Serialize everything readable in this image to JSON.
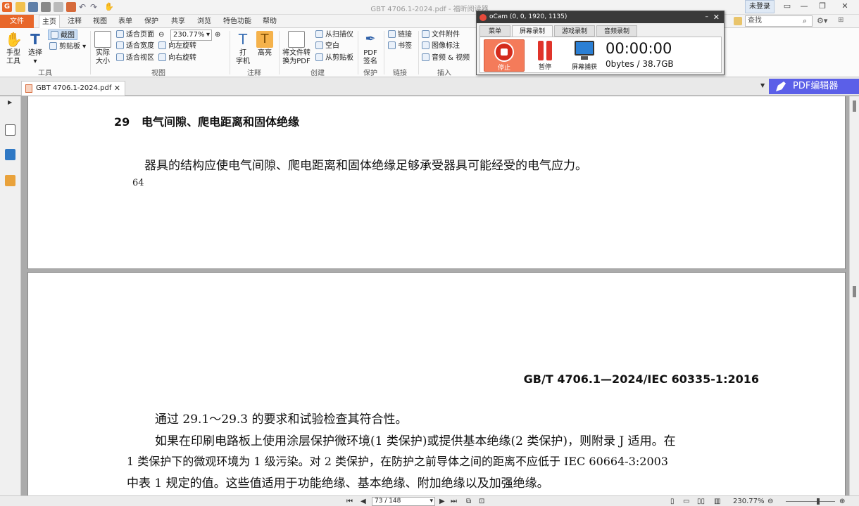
{
  "window": {
    "title": "GBT 4706.1-2024.pdf - 福昕阅读器",
    "login": "未登录",
    "app_logo_letter": "G"
  },
  "menu": {
    "file": "文件",
    "tabs": [
      "主页",
      "注释",
      "视图",
      "表单",
      "保护",
      "共享",
      "浏览",
      "特色功能",
      "帮助"
    ],
    "search_placeholder": "查找"
  },
  "ribbon": {
    "tools": {
      "hand": "手型\n工具",
      "select": "选择",
      "screenshot": "截图",
      "clipboard": "剪贴板",
      "group": "工具"
    },
    "view": {
      "actual_size": "实际\n大小",
      "fit_page": "适合页面",
      "fit_width": "适合宽度",
      "fit_view": "适合视区",
      "zoom_value": "230.77%",
      "rotate_left": "向左旋转",
      "rotate_right": "向右旋转",
      "group": "视图"
    },
    "annotate": {
      "typewriter": "打\n字机",
      "highlight": "高亮",
      "group": "注释"
    },
    "create": {
      "convert": "将文件转\n换为PDF",
      "from_scanner": "从扫描仪",
      "blank": "空白",
      "from_clipboard": "从剪贴板",
      "group": "创建"
    },
    "protect": {
      "sign": "PDF\n签名",
      "group": "保护"
    },
    "links": {
      "link": "链接",
      "bookmark": "书签",
      "group": "链接"
    },
    "insert": {
      "attachment": "文件附件",
      "image_annotation": "图像标注",
      "audio_video": "音频 & 视频",
      "group": "插入"
    }
  },
  "doc_tab": {
    "name": "GBT 4706.1-2024.pdf",
    "close": "✕"
  },
  "pdf_editor_label": "PDF编辑器",
  "page1": {
    "section_number": "29",
    "section_title": "电气间隙、爬电距离和固体绝缘",
    "paragraph": "器具的结构应使电气间隙、爬电距离和固体绝缘足够承受器具可能经受的电气应力。",
    "page_number": "64"
  },
  "page2": {
    "header": "GB/T  4706.1—2024/IEC 60335-1:2016",
    "line1": "通过 29.1～29.3 的要求和试验检查其符合性。",
    "line2": "如果在印刷电路板上使用涂层保护微环境(1 类保护)或提供基本绝缘(2 类保护)，则附录 J 适用。在",
    "line3": "1 类保护下的微观环境为 1 级污染。对 2 类保护，在防护之前导体之间的距离不应低于 IEC 60664-3:2003",
    "line4": "中表 1 规定的值。这些值适用于功能绝缘、基本绝缘、附加绝缘以及加强绝缘。"
  },
  "status": {
    "page": "73 / 148",
    "zoom": "230.77%"
  },
  "ocam": {
    "title": "oCam (0, 0, 1920, 1135)",
    "tabs": [
      "菜单",
      "屏幕录制",
      "游戏录制",
      "音频录制"
    ],
    "stop": "停止",
    "pause": "暂停",
    "capture": "屏幕捕获",
    "timer": "00:00:00",
    "size": "0bytes / 38.7GB"
  },
  "colors": {
    "accent": "#e8672a",
    "pdf_editor": "#5b5fe8",
    "ocam_stop": "#f47b5a"
  }
}
